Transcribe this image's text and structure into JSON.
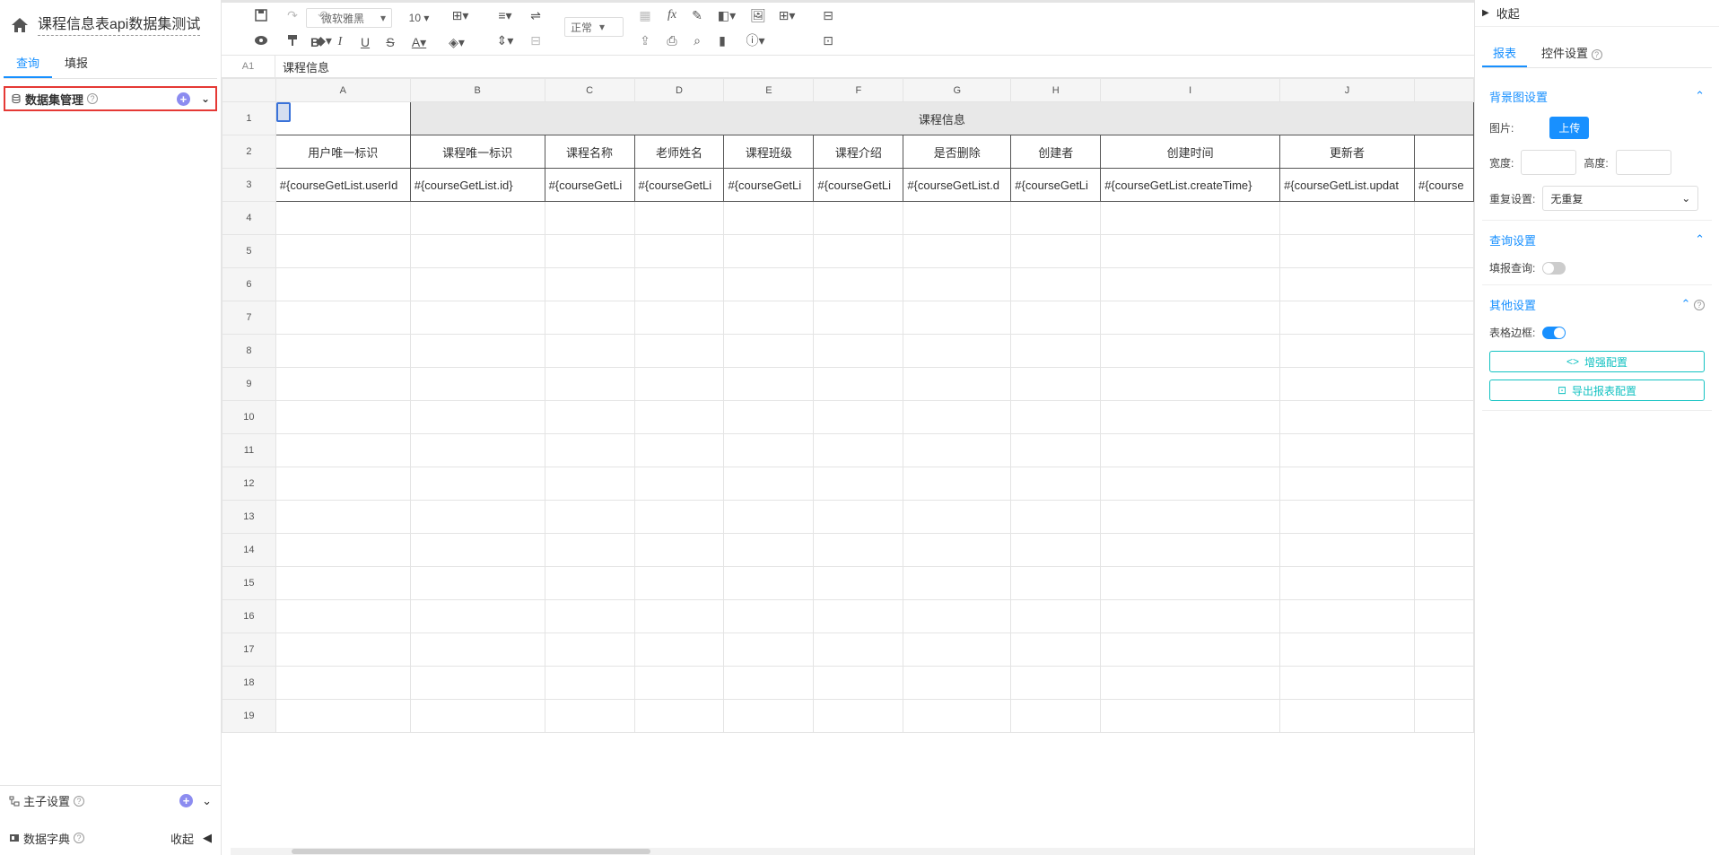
{
  "report": {
    "title": "课程信息表api数据集测试"
  },
  "left_tabs": [
    "查询",
    "填报"
  ],
  "dataset": {
    "label": "数据集管理"
  },
  "bottom": {
    "master_label": "主子设置",
    "dict_label": "数据字典",
    "collapse_label": "收起"
  },
  "toolbar": {
    "font": "微软雅黑",
    "size": "10",
    "style": "正常"
  },
  "formula": {
    "cell_ref": "A1",
    "value": "课程信息"
  },
  "grid": {
    "columns": [
      "A",
      "B",
      "C",
      "D",
      "E",
      "F",
      "G",
      "H",
      "I",
      "J",
      ""
    ],
    "rows": [
      "1",
      "2",
      "3",
      "4",
      "5",
      "6",
      "7",
      "8",
      "9",
      "10",
      "11",
      "12",
      "13",
      "14",
      "15",
      "16",
      "17",
      "18",
      "19"
    ],
    "merged_title": "课程信息",
    "headers": [
      "用户唯一标识",
      "课程唯一标识",
      "课程名称",
      "老师姓名",
      "课程班级",
      "课程介绍",
      "是否删除",
      "创建者",
      "创建时间",
      "更新者",
      ""
    ],
    "data": [
      "#{courseGetList.userId",
      "#{courseGetList.id}",
      "#{courseGetLi",
      "#{courseGetLi",
      "#{courseGetLi",
      "#{courseGetLi",
      "#{courseGetList.d",
      "#{courseGetLi",
      "#{courseGetList.createTime}",
      "#{courseGetList.updat",
      "#{course"
    ]
  },
  "right": {
    "collapse_label": "收起",
    "tabs": [
      "报表",
      "控件设置"
    ],
    "bg_section": "背景图设置",
    "image_label": "图片:",
    "upload_label": "上传",
    "width_label": "宽度:",
    "height_label": "高度:",
    "repeat_label": "重复设置:",
    "repeat_value": "无重复",
    "query_section": "查询设置",
    "fill_query_label": "填报查询:",
    "other_section": "其他设置",
    "border_label": "表格边框:",
    "enhance_label": "增强配置",
    "export_label": "导出报表配置"
  }
}
